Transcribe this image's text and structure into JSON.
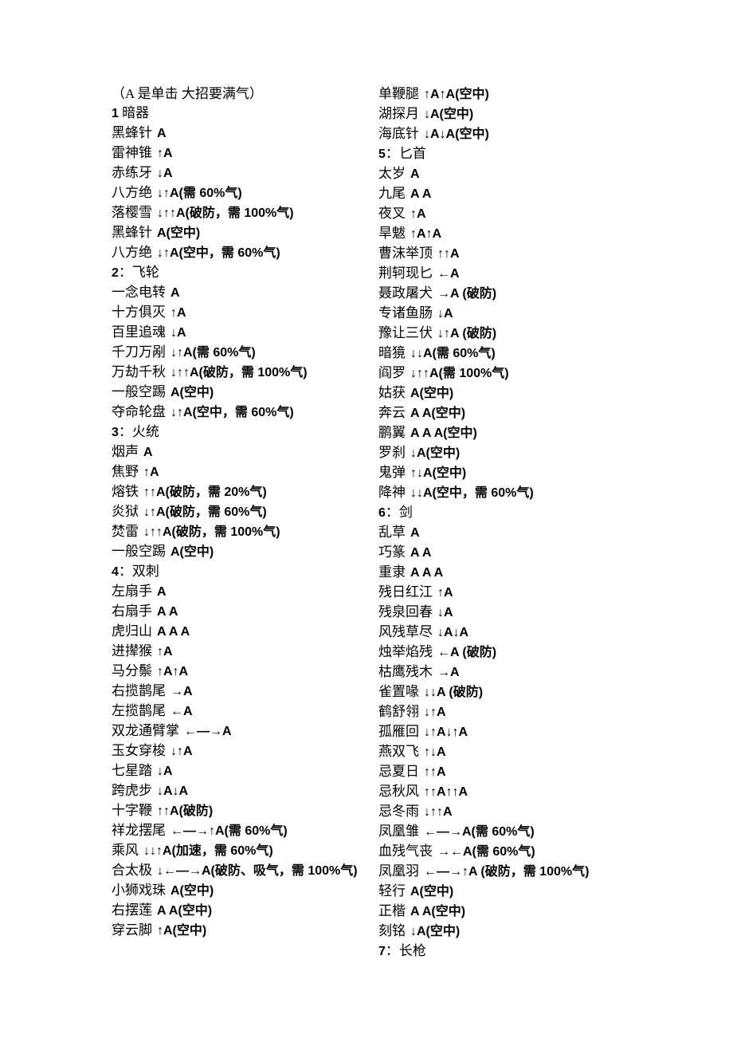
{
  "document": {
    "header_note": "（A 是单击 大招要满气）",
    "columns": [
      {
        "id": "left-column",
        "lines": [
          {
            "type": "section",
            "text": "1 暗器"
          },
          {
            "type": "move",
            "name": "黑蜂针",
            "cmd": "A"
          },
          {
            "type": "move",
            "name": "雷神锥",
            "cmd": "↑A"
          },
          {
            "type": "move",
            "name": "赤练牙",
            "cmd": "↓A"
          },
          {
            "type": "move",
            "name": "八方绝",
            "cmd": "↓↑A(需 60%气)"
          },
          {
            "type": "move",
            "name": "落樱雪",
            "cmd": "↓↑↑A(破防，需 100%气)"
          },
          {
            "type": "move",
            "name": "黑蜂针",
            "cmd": "A(空中)"
          },
          {
            "type": "move",
            "name": "八方绝",
            "cmd": "↓↑A(空中，需 60%气)"
          },
          {
            "type": "section",
            "text": "2：飞轮"
          },
          {
            "type": "move",
            "name": "一念电转",
            "cmd": "A"
          },
          {
            "type": "move",
            "name": "十方俱灭",
            "cmd": "↑A"
          },
          {
            "type": "move",
            "name": "百里追魂",
            "cmd": "↓A"
          },
          {
            "type": "move",
            "name": "千刀万剐",
            "cmd": "↓↑A(需 60%气)"
          },
          {
            "type": "move",
            "name": "万劫千秋",
            "cmd": "↓↑↑A(破防，需 100%气)"
          },
          {
            "type": "move",
            "name": "一般空踢",
            "cmd": "A(空中)"
          },
          {
            "type": "move",
            "name": "夺命轮盘",
            "cmd": "↓↑A(空中，需 60%气)"
          },
          {
            "type": "section",
            "text": "3：火统"
          },
          {
            "type": "move",
            "name": "烟声",
            "cmd": "A"
          },
          {
            "type": "move",
            "name": "焦野",
            "cmd": "↑A"
          },
          {
            "type": "move",
            "name": "熔铁",
            "cmd": "↑↑A(破防，需 20%气)"
          },
          {
            "type": "move",
            "name": "炎狱",
            "cmd": "↓↑A(破防，需 60%气)"
          },
          {
            "type": "move",
            "name": "焚雷",
            "cmd": "↓↑↑A(破防，需 100%气)"
          },
          {
            "type": "move",
            "name": "一般空踢",
            "cmd": "A(空中)"
          },
          {
            "type": "section",
            "text": "4：双刺"
          },
          {
            "type": "move",
            "name": "左扇手",
            "cmd": "A"
          },
          {
            "type": "move",
            "name": "右扇手",
            "cmd": "A A"
          },
          {
            "type": "move",
            "name": "虎归山",
            "cmd": "A A A"
          },
          {
            "type": "move",
            "name": "进撵猴",
            "cmd": "↑A"
          },
          {
            "type": "move",
            "name": "马分鬃",
            "cmd": "↑A↑A"
          },
          {
            "type": "move",
            "name": "右揽鹊尾",
            "cmd": "→A"
          },
          {
            "type": "move",
            "name": "左揽鹊尾",
            "cmd": "←A"
          },
          {
            "type": "move",
            "name": "双龙通臂掌",
            "cmd": "←—→A"
          },
          {
            "type": "move",
            "name": "玉女穿梭",
            "cmd": "↓↑A"
          },
          {
            "type": "move",
            "name": "七星踏",
            "cmd": "↓A"
          },
          {
            "type": "move",
            "name": "跨虎步",
            "cmd": "↓A↓A"
          },
          {
            "type": "move",
            "name": "十字鞭",
            "cmd": "↑↑A(破防)"
          },
          {
            "type": "move",
            "name": "祥龙摆尾",
            "cmd": "←—→↑A(需 60%气)"
          },
          {
            "type": "move",
            "name": "乘风",
            "cmd": "↓↓↑A(加速，需 60%气)"
          },
          {
            "type": "move",
            "name": "合太极",
            "cmd": "↓←—→A(破防、吸气，需 100%气)"
          },
          {
            "type": "move",
            "name": "小狮戏珠",
            "cmd": "A(空中)"
          },
          {
            "type": "move",
            "name": "右摆莲",
            "cmd": "A A(空中)"
          },
          {
            "type": "move",
            "name": "穿云脚",
            "cmd": "↑A(空中)"
          }
        ]
      },
      {
        "id": "right-column",
        "lines": [
          {
            "type": "move",
            "name": "单鞭腿",
            "cmd": "↑A↑A(空中)"
          },
          {
            "type": "move",
            "name": "湖探月",
            "cmd": "↓A(空中)"
          },
          {
            "type": "move",
            "name": "海底针",
            "cmd": "↓A↓A(空中)"
          },
          {
            "type": "section",
            "text": "5：匕首"
          },
          {
            "type": "move",
            "name": "太岁",
            "cmd": "A"
          },
          {
            "type": "move",
            "name": "九尾",
            "cmd": "A A"
          },
          {
            "type": "move",
            "name": "夜叉",
            "cmd": "↑A"
          },
          {
            "type": "move",
            "name": "旱魃",
            "cmd": "↑A↑A"
          },
          {
            "type": "move",
            "name": "曹沫举顶",
            "cmd": "↑↑A"
          },
          {
            "type": "move",
            "name": "荆轲现匕",
            "cmd": "←A"
          },
          {
            "type": "move",
            "name": "聂政屠犬",
            "cmd": "→A (破防)"
          },
          {
            "type": "move",
            "name": "专诸鱼肠",
            "cmd": "↓A"
          },
          {
            "type": "move",
            "name": "豫让三伏",
            "cmd": "↓↑A (破防)"
          },
          {
            "type": "move",
            "name": "暗獍",
            "cmd": "↓↓A(需 60%气)"
          },
          {
            "type": "move",
            "name": "阎罗",
            "cmd": "↓↑↑A(需 100%气)"
          },
          {
            "type": "move",
            "name": "姑获",
            "cmd": "A(空中)"
          },
          {
            "type": "move",
            "name": "奔云",
            "cmd": "A A(空中)"
          },
          {
            "type": "move",
            "name": "鹏翼",
            "cmd": "A A A(空中)"
          },
          {
            "type": "move",
            "name": "罗刹",
            "cmd": "↓A(空中)"
          },
          {
            "type": "move",
            "name": "鬼弹",
            "cmd": "↑↓A(空中)"
          },
          {
            "type": "move",
            "name": "降神",
            "cmd": "↓↓A(空中，需 60%气)"
          },
          {
            "type": "section",
            "text": "6：剑"
          },
          {
            "type": "move",
            "name": "乱草",
            "cmd": "A"
          },
          {
            "type": "move",
            "name": "巧篆",
            "cmd": "A A"
          },
          {
            "type": "move",
            "name": "重隶",
            "cmd": "A A A"
          },
          {
            "type": "move",
            "name": "残日红江",
            "cmd": "↑A"
          },
          {
            "type": "move",
            "name": "残泉回春",
            "cmd": "↓A"
          },
          {
            "type": "move",
            "name": "风残草尽",
            "cmd": "↓A↓A"
          },
          {
            "type": "move",
            "name": "烛举焰残",
            "cmd": "←A (破防)"
          },
          {
            "type": "move",
            "name": "枯鹰残木",
            "cmd": "→A"
          },
          {
            "type": "move",
            "name": "雀置喙",
            "cmd": "↓↓A (破防)"
          },
          {
            "type": "move",
            "name": "鹤舒翎",
            "cmd": "↓↑A"
          },
          {
            "type": "move",
            "name": "孤雁回",
            "cmd": "↓↑A↓↑A"
          },
          {
            "type": "move",
            "name": "燕双飞",
            "cmd": "↑↓A"
          },
          {
            "type": "move",
            "name": "忌夏日",
            "cmd": "↑↑A"
          },
          {
            "type": "move",
            "name": "忌秋风",
            "cmd": "↑↑A↑↑A"
          },
          {
            "type": "move",
            "name": "忌冬雨",
            "cmd": "↓↑↑A"
          },
          {
            "type": "move",
            "name": "凤凰雏",
            "cmd": "←—→A(需 60%气)"
          },
          {
            "type": "move",
            "name": "血残气丧",
            "cmd": "→←A(需 60%气)"
          },
          {
            "type": "move",
            "name": "凤凰羽",
            "cmd": "←—→↑A (破防，需 100%气)"
          },
          {
            "type": "move",
            "name": "轻行",
            "cmd": "A(空中)"
          },
          {
            "type": "move",
            "name": "正楷",
            "cmd": "A A(空中)"
          },
          {
            "type": "move",
            "name": "刻铭",
            "cmd": "↓A(空中)"
          },
          {
            "type": "section",
            "text": "7：长枪"
          }
        ]
      }
    ]
  }
}
